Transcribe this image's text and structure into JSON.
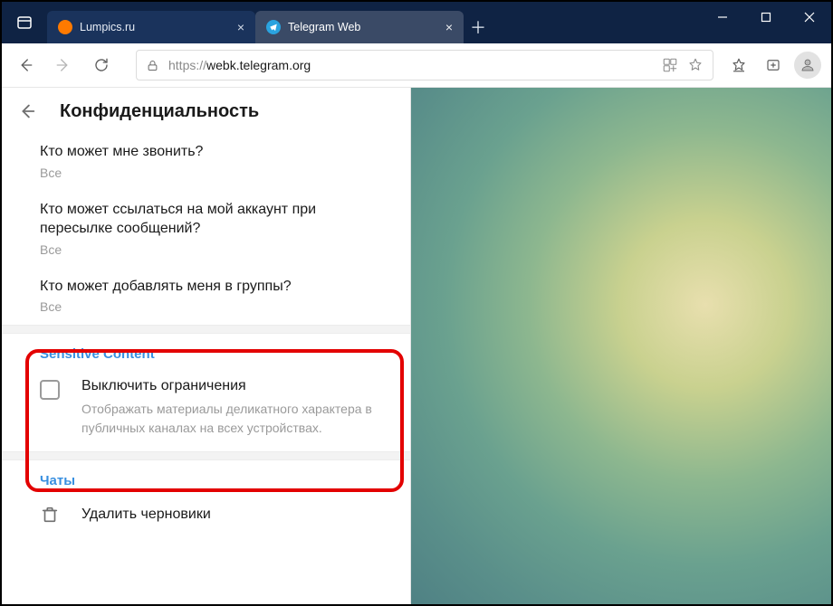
{
  "browser": {
    "tabs": [
      {
        "title": "Lumpics.ru",
        "favicon": "orange",
        "active": false
      },
      {
        "title": "Telegram Web",
        "favicon": "telegram",
        "active": true
      }
    ],
    "url_scheme": "https://",
    "url_host": "webk.telegram.org"
  },
  "panel": {
    "title": "Конфиденциальность",
    "items": [
      {
        "question": "Кто может мне звонить?",
        "value": "Все"
      },
      {
        "question": "Кто может ссылаться на мой аккаунт при пересылке сообщений?",
        "value": "Все"
      },
      {
        "question": "Кто может добавлять меня в группы?",
        "value": "Все"
      }
    ],
    "sensitive": {
      "section_title": "Sensitive Content",
      "checkbox_label": "Выключить ограничения",
      "checkbox_desc": "Отображать материалы деликатного характера в публичных каналах на всех устройствах.",
      "checked": false
    },
    "chats_title": "Чаты",
    "delete_drafts": "Удалить черновики"
  }
}
